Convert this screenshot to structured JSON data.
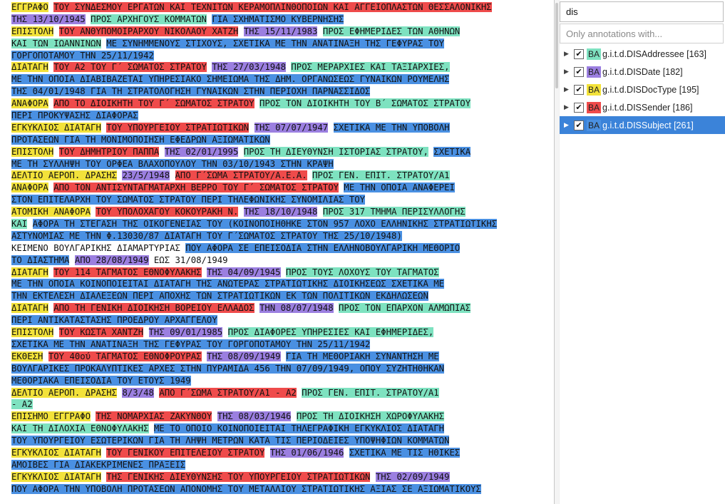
{
  "colors": {
    "DISAddressee": "#7ee2c0",
    "DISDate": "#9b7fe0",
    "DISDocType": "#f3e23a",
    "DISSender": "#ef4b4b",
    "DISSubject": "#4a90e2",
    "selection": "#3b83d9"
  },
  "document": {
    "lines": [
      [
        {
          "t": "ΕΓΓΡΑΦΟ",
          "c": "DISDocType"
        },
        {
          "t": " "
        },
        {
          "t": "ΤΟΥ ΣΥΝΔΕΣΜΟΥ ΕΡΓΑΤΩΝ ΚΑΙ ΤΕΧΝΙΤΩΝ ΚΕΡΑΜΟΠΛΙΝΘΟΠΟΙΩΝ ΚΑΙ ΑΓΓΕΙΟΠΛΑΣΤΩΝ ΘΕΣΣΑΛΟΝΙΚΗΣ",
          "c": "DISSender"
        }
      ],
      [
        {
          "t": "ΤΗΣ 13/10/1945",
          "c": "DISDate"
        },
        {
          "t": " "
        },
        {
          "t": "ΠΡΟΣ ΑΡΧΗΓΟΥΣ ΚΟΜΜΑΤΩΝ",
          "c": "DISAddressee"
        },
        {
          "t": " "
        },
        {
          "t": "ΓΙΑ ΣΧΗΜΑΤΙΣΜΟ ΚΥΒΕΡΝΗΣΗΣ",
          "c": "DISSubject"
        }
      ],
      [
        {
          "t": "ΕΠΙΣΤΟΛΗ",
          "c": "DISDocType"
        },
        {
          "t": " "
        },
        {
          "t": "ΤΟΥ ΑΝΘΥΠΟΜΟΙΡΑΡΧΟΥ ΝΙΚΟΛΑΟΥ ΧΑΤΖΗ",
          "c": "DISSender"
        },
        {
          "t": " "
        },
        {
          "t": "ΤΗΣ 15/11/1983",
          "c": "DISDate"
        },
        {
          "t": " "
        },
        {
          "t": "ΠΡΟΣ ΕΦΗΜΕΡΙΔΕΣ ΤΩΝ ΑΘΗΝΩΝ",
          "c": "DISAddressee"
        }
      ],
      [
        {
          "t": "ΚΑΙ ΤΩΝ ΙΩΑΝΝΙΝΩΝ",
          "c": "DISAddressee"
        },
        {
          "t": " "
        },
        {
          "t": "ΜΕ ΣΥΝΗΜΜΕΝΟΥΣ ΣΤΙΧΟΥΣ, ΣΧΕΤΙΚΑ ΜΕ ΤΗΝ ΑΝΑΤΙΝΑΞΗ ΤΗΣ ΓΕΦΥΡΑΣ ΤΟΥ",
          "c": "DISSubject"
        }
      ],
      [
        {
          "t": "ΓΟΡΓΟΠΟΤΑΜΟΥ ΤΗΝ 25/11/1942",
          "c": "DISSubject"
        }
      ],
      [
        {
          "t": "ΔΙΑΤΑΓΗ",
          "c": "DISDocType"
        },
        {
          "t": " "
        },
        {
          "t": "ΤΟΥ Α2 ΤΟΥ Γ΄ ΣΩΜΑΤΟΣ ΣΤΡΑΤΟΥ",
          "c": "DISSender"
        },
        {
          "t": " "
        },
        {
          "t": "ΤΗΣ 27/03/1948",
          "c": "DISDate"
        },
        {
          "t": " "
        },
        {
          "t": "ΠΡΟΣ ΜΕΡΑΡΧΙΕΣ ΚΑΙ ΤΑΞΙΑΡΧΙΕΣ,",
          "c": "DISAddressee"
        }
      ],
      [
        {
          "t": "ΜΕ ΤΗΝ ΟΠΟΙΑ ΔΙΑΒΙΒΑΖΕΤΑΙ ΥΠΗΡΕΣΙΑΚΟ ΣΗΜΕΙΩΜΑ ΤΗΣ ΔΗΜ. ΟΡΓΑΝΩΣΕΩΣ ΓΥΝΑΙΚΩΝ ΡΟΥΜΕΛΗΣ",
          "c": "DISSubject"
        }
      ],
      [
        {
          "t": "ΤΗΣ 04/01/1948 ΓΙΑ ΤΗ ΣΤΡΑΤΟΛΟΓΗΣΗ ΓΥΝΑΙΚΩΝ ΣΤΗΝ ΠΕΡΙΟΧΗ ΠΑΡΝΑΣΣΙΔΟΣ",
          "c": "DISSubject"
        }
      ],
      [
        {
          "t": "ΑΝΑΦΟΡΑ",
          "c": "DISDocType"
        },
        {
          "t": " "
        },
        {
          "t": "ΑΠΟ ΤΟ ΔΙΟΙΚΗΤΗ ΤΟΥ Γ΄ ΣΩΜΑΤΟΣ ΣΤΡΑΤΟΥ",
          "c": "DISSender"
        },
        {
          "t": " "
        },
        {
          "t": "ΠΡΟΣ ΤΟΝ ΔΙΟΙΚΗΤΗ ΤΟΥ Β΄ ΣΩΜΑΤΟΣ ΣΤΡΑΤΟΥ",
          "c": "DISAddressee"
        }
      ],
      [
        {
          "t": "ΠΕΡΙ ΠΡΟΚΥΨΑΣΗΣ ΔΙΑΦΟΡΑΣ",
          "c": "DISSubject"
        }
      ],
      [
        {
          "t": "ΕΓΚΥΚΛΙΟΣ ΔΙΑΤΑΓΗ",
          "c": "DISDocType"
        },
        {
          "t": " "
        },
        {
          "t": "ΤΟΥ ΥΠΟΥΡΓΕΙΟΥ ΣΤΡΑΤΙΩΤΙΚΩΝ",
          "c": "DISSender"
        },
        {
          "t": " "
        },
        {
          "t": "ΤΗΣ 07/07/1947",
          "c": "DISDate"
        },
        {
          "t": " "
        },
        {
          "t": "ΣΧΕΤΙΚΑ ΜΕ ΤΗΝ ΥΠΟΒΟΛΗ",
          "c": "DISSubject"
        }
      ],
      [
        {
          "t": "ΠΡΟΤΑΣΕΩΝ ΓΙΑ ΤΗ ΜΟΝΙΜΟΠΟΙΗΣΗ ΕΦΕΔΡΩΝ ΑΞΙΩΜΑΤΙΚΩΝ",
          "c": "DISSubject"
        }
      ],
      [
        {
          "t": "ΕΠΙΣΤΟΛΗ",
          "c": "DISDocType"
        },
        {
          "t": " "
        },
        {
          "t": "ΤΟΥ ΔΗΜΗΤΡΙΟΥ ΠΑΠΠΑ",
          "c": "DISSender"
        },
        {
          "t": " "
        },
        {
          "t": "ΤΗΣ 02/01/1995",
          "c": "DISDate"
        },
        {
          "t": " "
        },
        {
          "t": "ΠΡΟΣ ΤΗ ΔΙΕΥΘΥΝΣΗ ΙΣΤΟΡΙΑΣ ΣΤΡΑΤΟΥ,",
          "c": "DISAddressee"
        },
        {
          "t": " "
        },
        {
          "t": "ΣΧΕΤΙΚΑ",
          "c": "DISSubject"
        }
      ],
      [
        {
          "t": "ΜΕ ΤΗ ΣΥΛΛΗΨΗ ΤΟΥ ΟΡΦΕΑ ΒΛΑΧΟΠΟΥΛΟΥ ΤΗΝ 03/10/1943 ΣΤΗΝ ΚΡΑΨΗ",
          "c": "DISSubject"
        }
      ],
      [
        {
          "t": "ΔΕΛΤΙΟ ΑΕΡΟΠ. ΔΡΑΣΗΣ",
          "c": "DISDocType"
        },
        {
          "t": " "
        },
        {
          "t": "23/5/1948",
          "c": "DISDate"
        },
        {
          "t": " "
        },
        {
          "t": "ΑΠΟ Γ΄ΣΩΜΑ ΣΤΡΑΤΟΥ/Α.Ε.Α.",
          "c": "DISSender"
        },
        {
          "t": " "
        },
        {
          "t": "ΠΡΟΣ ΓΕΝ. ΕΠΙΤ. ΣΤΡΑΤΟΥ/Α1",
          "c": "DISAddressee"
        }
      ],
      [
        {
          "t": "ΑΝΑΦΟΡΑ",
          "c": "DISDocType"
        },
        {
          "t": " "
        },
        {
          "t": "ΑΠΟ ΤΟΝ ΑΝΤΙΣΥΝΤΑΓΜΑΤΑΡΧΗ ΒΕΡΡΟ ΤΟΥ Γ΄ ΣΩΜΑΤΟΣ ΣΤΡΑΤΟΥ",
          "c": "DISSender"
        },
        {
          "t": " "
        },
        {
          "t": "ΜΕ ΤΗΝ ΟΠΟΙΑ ΑΝΑΦΕΡΕΙ",
          "c": "DISSubject"
        }
      ],
      [
        {
          "t": "ΣΤΟΝ ΕΠΙΤΕΛΑΡΧΗ ΤΟΥ ΣΩΜΑΤΟΣ ΣΤΡΑΤΟΥ ΠΕΡΙ ΤΗΛΕΦΩΝΙΚΗΣ ΣΥΝΟΜΙΛΙΑΣ ΤΟΥ",
          "c": "DISSubject"
        }
      ],
      [
        {
          "t": "ΑΤΟΜΙΚΗ ΑΝΑΦΟΡΑ",
          "c": "DISDocType"
        },
        {
          "t": " "
        },
        {
          "t": "ΤΟΥ ΥΠΟΛΟΧΑΓΟΥ ΚΟΚΟΥΡΑΚΗ Ν.",
          "c": "DISSender"
        },
        {
          "t": " "
        },
        {
          "t": "ΤΗΣ 18/10/1948",
          "c": "DISDate"
        },
        {
          "t": " "
        },
        {
          "t": "ΠΡΟΣ 317 ΤΜΗΜΑ ΠΕΡΙΣΥΛΛΟΓΗΣ",
          "c": "DISAddressee"
        }
      ],
      [
        {
          "t": "ΚΑΙ",
          "c": "DISAddressee"
        },
        {
          "t": " "
        },
        {
          "t": "ΑΦΟΡΑ ΤΗ ΣΤΕΓΑΣΗ ΤΗΣ ΟΙΚΟΓΕΝΕΙΑΣ ΤΟΥ (ΚΟΙΝΟΠΟΙΗΘΗΚΕ ΣΤΟΝ 957 ΛΟΧΟ ΕΛΛΗΝΙΚΗΣ ΣΤΡΑΤΙΩΤΙΚΗΣ",
          "c": "DISSubject"
        }
      ],
      [
        {
          "t": "ΑΣΤΥΝΟΜΙΑΣ ΜΕ ΤΗΝ Φ.13030/87 ΔΙΑΤΑΓΗ ΤΟΥ Γ΄ΣΩΜΑΤΟΣ ΣΤΡΑΤΟΥ ΤΗΣ 25/10/1948)",
          "c": "DISSubject"
        }
      ],
      [
        {
          "t": "ΚΕΙΜΕΝΟ ΒΟΥΛΓΑΡΙΚΗΣ ΔΙΑΜΑΡΤΥΡΙΑΣ"
        },
        {
          "t": " "
        },
        {
          "t": "ΠΟΥ ΑΦΟΡΑ ΣΕ ΕΠΕΙΣΟΔΙΑ ΣΤΗΝ ΕΛΛΗΝΟΒΟΥΛΓΑΡΙΚΗ ΜΕΘΟΡΙΟ",
          "c": "DISSubject"
        }
      ],
      [
        {
          "t": "ΤΟ ΔΙΑΣΤΗΜΑ",
          "c": "DISSubject"
        },
        {
          "t": " "
        },
        {
          "t": "ΑΠΟ 28/08/1949",
          "c": "DISDate"
        },
        {
          "t": " ΕΩΣ 31/08/1949"
        }
      ],
      [
        {
          "t": "ΔΙΑΤΑΓΗ",
          "c": "DISDocType"
        },
        {
          "t": " "
        },
        {
          "t": "ΤΟΥ 114 ΤΑΓΜΑΤΟΣ ΕΘΝΟΦΥΛΑΚΗΣ",
          "c": "DISSender"
        },
        {
          "t": " "
        },
        {
          "t": "ΤΗΣ 04/09/1945",
          "c": "DISDate"
        },
        {
          "t": " "
        },
        {
          "t": "ΠΡΟΣ ΤΟΥΣ ΛΟΧΟΥΣ ΤΟΥ ΤΑΓΜΑΤΟΣ",
          "c": "DISAddressee"
        }
      ],
      [
        {
          "t": "ΜΕ ΤΗΝ ΟΠΟΙΑ ΚΟΙΝΟΠΟΙΕΙΤΑΙ ΔΙΑΤΑΓΗ ΤΗΣ ΑΝΩΤΕΡΑΣ ΣΤΡΑΤΙΩΤΙΚΗΣ ΔΙΟΙΚΗΣΕΩΣ ΣΧΕΤΙΚΑ ΜΕ",
          "c": "DISSubject"
        }
      ],
      [
        {
          "t": "ΤΗΝ ΕΚΤΕΛΕΣΗ ΔΙΑΛΕΞΕΩΝ ΠΕΡΙ ΑΠΟΧΗΣ ΤΩΝ ΣΤΡΑΤΙΩΤΙΚΩΝ ΕΚ ΤΩΝ ΠΟΛΙΤΙΚΩΝ ΕΚΔΗΛΩΣΕΩΝ",
          "c": "DISSubject"
        }
      ],
      [
        {
          "t": "ΔΙΑΤΑΓΗ",
          "c": "DISDocType"
        },
        {
          "t": " "
        },
        {
          "t": "ΑΠΟ ΤΗ ΓΕΝΙΚΗ ΔΙΟΙΚΗΣΗ ΒΟΡΕΙΟΥ ΕΛΛΑΔΟΣ",
          "c": "DISSender"
        },
        {
          "t": " "
        },
        {
          "t": "ΤΗΝ 08/07/1948",
          "c": "DISDate"
        },
        {
          "t": " "
        },
        {
          "t": "ΠΡΟΣ ΤΟΝ ΕΠΑΡΧΟΝ ΑΛΜΩΠΙΑΣ",
          "c": "DISAddressee"
        }
      ],
      [
        {
          "t": "ΠΕΡΙ ΑΝΤΙΚΑΤΑΣΤΑΣΗΣ ΠΡΟΕΔΡΟΥ ΑΡΧΑΓΓΕΛΟΥ",
          "c": "DISSubject"
        }
      ],
      [
        {
          "t": "ΕΠΙΣΤΟΛΗ",
          "c": "DISDocType"
        },
        {
          "t": " "
        },
        {
          "t": "ΤΟΥ ΚΩΣΤΑ ΧΑΝΤΖΗ",
          "c": "DISSender"
        },
        {
          "t": " "
        },
        {
          "t": "ΤΗΣ 09/01/1985",
          "c": "DISDate"
        },
        {
          "t": " "
        },
        {
          "t": "ΠΡΟΣ ΔΙΑΦΟΡΕΣ ΥΠΗΡΕΣΙΕΣ ΚΑΙ ΕΦΗΜΕΡΙΔΕΣ,",
          "c": "DISAddressee"
        }
      ],
      [
        {
          "t": "ΣΧΕΤΙΚΑ ΜΕ ΤΗΝ ΑΝΑΤΙΝΑΞΗ ΤΗΣ ΓΕΦΥΡΑΣ ΤΟΥ ΓΟΡΓΟΠΟΤΑΜΟΥ ΤΗΝ 25/11/1942",
          "c": "DISSubject"
        }
      ],
      [
        {
          "t": "ΕΚΘΕΣΗ",
          "c": "DISDocType"
        },
        {
          "t": " "
        },
        {
          "t": "ΤΟΥ 40ού ΤΑΓΜΑΤΟΣ ΕΘΝΟΦΡΟΥΡΑΣ",
          "c": "DISSender"
        },
        {
          "t": " "
        },
        {
          "t": "ΤΗΣ 08/09/1949",
          "c": "DISDate"
        },
        {
          "t": " "
        },
        {
          "t": "ΓΙΑ ΤΗ ΜΕΘΟΡΙΑΚΗ ΣΥΝΑΝΤΗΣΗ ΜΕ",
          "c": "DISSubject"
        }
      ],
      [
        {
          "t": "ΒΟΥΛΓΑΡΙΚΕΣ ΠΡΟΚΑΛΥΠΤΙΚΕΣ ΑΡΧΕΣ ΣΤΗΝ ΠΥΡΑΜΙΔΑ 456 ΤΗΝ 07/09/1949, ΟΠΟΥ ΣΥΖΗΤΗΘΗΚΑΝ",
          "c": "DISSubject"
        }
      ],
      [
        {
          "t": "ΜΕΘΟΡΙΑΚΑ ΕΠΕΙΣΟΔΙΑ ΤΟΥ ΕΤΟΥΣ 1949",
          "c": "DISSubject"
        }
      ],
      [
        {
          "t": "ΔΕΛΤΙΟ ΑΕΡΟΠ. ΔΡΑΣΗΣ",
          "c": "DISDocType"
        },
        {
          "t": " "
        },
        {
          "t": "8/3/48",
          "c": "DISDate"
        },
        {
          "t": " "
        },
        {
          "t": "ΑΠΟ Γ΄ΣΩΜΑ ΣΤΡΑΤΟΥ/Α1 - Α2",
          "c": "DISSender"
        },
        {
          "t": " "
        },
        {
          "t": "ΠΡΟΣ ΓΕΝ. ΕΠΙΤ. ΣΤΡΑΤΟΥ/Α1",
          "c": "DISAddressee"
        }
      ],
      [
        {
          "t": "- Α2",
          "c": "DISAddressee"
        }
      ],
      [
        {
          "t": "ΕΠΙΣΗΜΟ ΕΓΓΡΑΦΟ",
          "c": "DISDocType"
        },
        {
          "t": " "
        },
        {
          "t": "ΤΗΣ ΝΟΜΑΡΧΙΑΣ ΖΑΚΥΝΘΟΥ",
          "c": "DISSender"
        },
        {
          "t": " "
        },
        {
          "t": "ΤΗΣ 08/03/1946",
          "c": "DISDate"
        },
        {
          "t": " "
        },
        {
          "t": "ΠΡΟΣ ΤΗ ΔΙΟΙΚΗΣΗ ΧΩΡΟΦΥΛΑΚΗΣ",
          "c": "DISAddressee"
        }
      ],
      [
        {
          "t": "ΚΑΙ ΤΗ ΔΙΛΟΧΙΑ ΕΘΝΟΦΥΛΑΚΗΣ",
          "c": "DISAddressee"
        },
        {
          "t": " "
        },
        {
          "t": "ΜΕ ΤΟ ΟΠΟΙΟ ΚΟΙΝΟΠΟΙΕΙΤΑΙ ΤΗΛΕΓΡΑΦΙΚΗ ΕΓΚΥΚΛΙΟΣ ΔΙΑΤΑΓΗ",
          "c": "DISSubject"
        }
      ],
      [
        {
          "t": "ΤΟΥ ΥΠΟΥΡΓΕΙΟΥ ΕΣΩΤΕΡΙΚΩΝ ΓΙΑ ΤΗ ΛΗΨΗ ΜΕΤΡΩΝ ΚΑΤΑ ΤΙΣ ΠΕΡΙΟΔΕΙΕΣ ΥΠΟΨΗΦΙΩΝ ΚΟΜΜΑΤΩΝ",
          "c": "DISSubject"
        }
      ],
      [
        {
          "t": "ΕΓΚΥΚΛΙΟΣ ΔΙΑΤΑΓΗ",
          "c": "DISDocType"
        },
        {
          "t": " "
        },
        {
          "t": "ΤΟΥ ΓΕΝΙΚΟΥ ΕΠΙΤΕΛΕΙΟΥ ΣΤΡΑΤΟΥ",
          "c": "DISSender"
        },
        {
          "t": " "
        },
        {
          "t": "ΤΗΣ 01/06/1946",
          "c": "DISDate"
        },
        {
          "t": " "
        },
        {
          "t": "ΣΧΕΤΙΚΑ ΜΕ ΤΙΣ ΗΘΙΚΕΣ",
          "c": "DISSubject"
        }
      ],
      [
        {
          "t": "ΑΜΟΙΒΕΣ ΓΙΑ ΔΙΑΚΕΚΡΙΜΕΝΕΣ ΠΡΑΞΕΙΣ",
          "c": "DISSubject"
        }
      ],
      [
        {
          "t": "ΕΓΚΥΚΛΙΟΣ ΔΙΑΤΑΓΗ",
          "c": "DISDocType"
        },
        {
          "t": " "
        },
        {
          "t": "ΤΗΣ ΓΕΝΙΚΗΣ ΔΙΕΥΘΥΝΣΗΣ ΤΟΥ ΥΠΟΥΡΓΕΙΟΥ ΣΤΡΑΤΙΩΤΙΚΩΝ",
          "c": "DISSender"
        },
        {
          "t": " "
        },
        {
          "t": "ΤΗΣ 02/09/1949",
          "c": "DISDate"
        }
      ],
      [
        {
          "t": "ΠΟΥ ΑΦΟΡΑ ΤΗΝ ΥΠΟΒΟΛΗ ΠΡΟΤΑΣΕΩΝ ΑΠΟΝΟΜΗΣ ΤΟΥ ΜΕΤΑΛΛΙΟΥ ΣΤΡΑΤΙΩΤΙΚΗΣ ΑΞΙΑΣ ΣΕ ΑΞΙΩΜΑΤΙΚΟΥΣ",
          "c": "DISSubject"
        }
      ]
    ]
  },
  "sidebar": {
    "search_value": "dis",
    "filter_placeholder": "Only annotations with...",
    "items": [
      {
        "key": "DISAddressee",
        "badge": "BA",
        "label": "g.i.t.d.DISAddressee [163]",
        "checked": true,
        "selected": false,
        "expander": "▶",
        "check": "✔"
      },
      {
        "key": "DISDate",
        "badge": "BA",
        "label": "g.i.t.d.DISDate [182]",
        "checked": true,
        "selected": false,
        "expander": "▶",
        "check": "✔"
      },
      {
        "key": "DISDocType",
        "badge": "BA",
        "label": "g.i.t.d.DISDocType [195]",
        "checked": true,
        "selected": false,
        "expander": "▶",
        "check": "✔"
      },
      {
        "key": "DISSender",
        "badge": "BA",
        "label": "g.i.t.d.DISSender [186]",
        "checked": true,
        "selected": false,
        "expander": "▶",
        "check": "✔"
      },
      {
        "key": "DISSubject",
        "badge": "BA",
        "label": "g.i.t.d.DISSubject [261]",
        "checked": true,
        "selected": true,
        "expander": "▶",
        "check": "✔"
      }
    ]
  }
}
